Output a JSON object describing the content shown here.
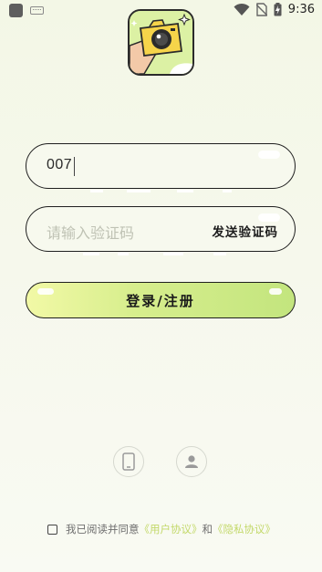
{
  "status_bar": {
    "time": "9:36",
    "icons": [
      "app-notification-icon",
      "keyboard-icon",
      "wifi-icon",
      "no-sim-icon",
      "battery-charging-icon"
    ]
  },
  "app": {
    "logo_icon": "camera-in-hand-icon",
    "accent_color": "#cbe77f"
  },
  "phone_input": {
    "value": "007"
  },
  "code_input": {
    "placeholder": "请输入验证码",
    "send_code_label": "发送验证码"
  },
  "login_button": {
    "label": "登录/注册"
  },
  "alt_login": {
    "items": [
      {
        "icon": "phone-icon"
      },
      {
        "icon": "user-icon"
      }
    ]
  },
  "agreement": {
    "prefix": "我已阅读并同意",
    "user_agreement": "《用户协议》",
    "conjunction": "和",
    "privacy_policy": "《隐私协议》"
  }
}
